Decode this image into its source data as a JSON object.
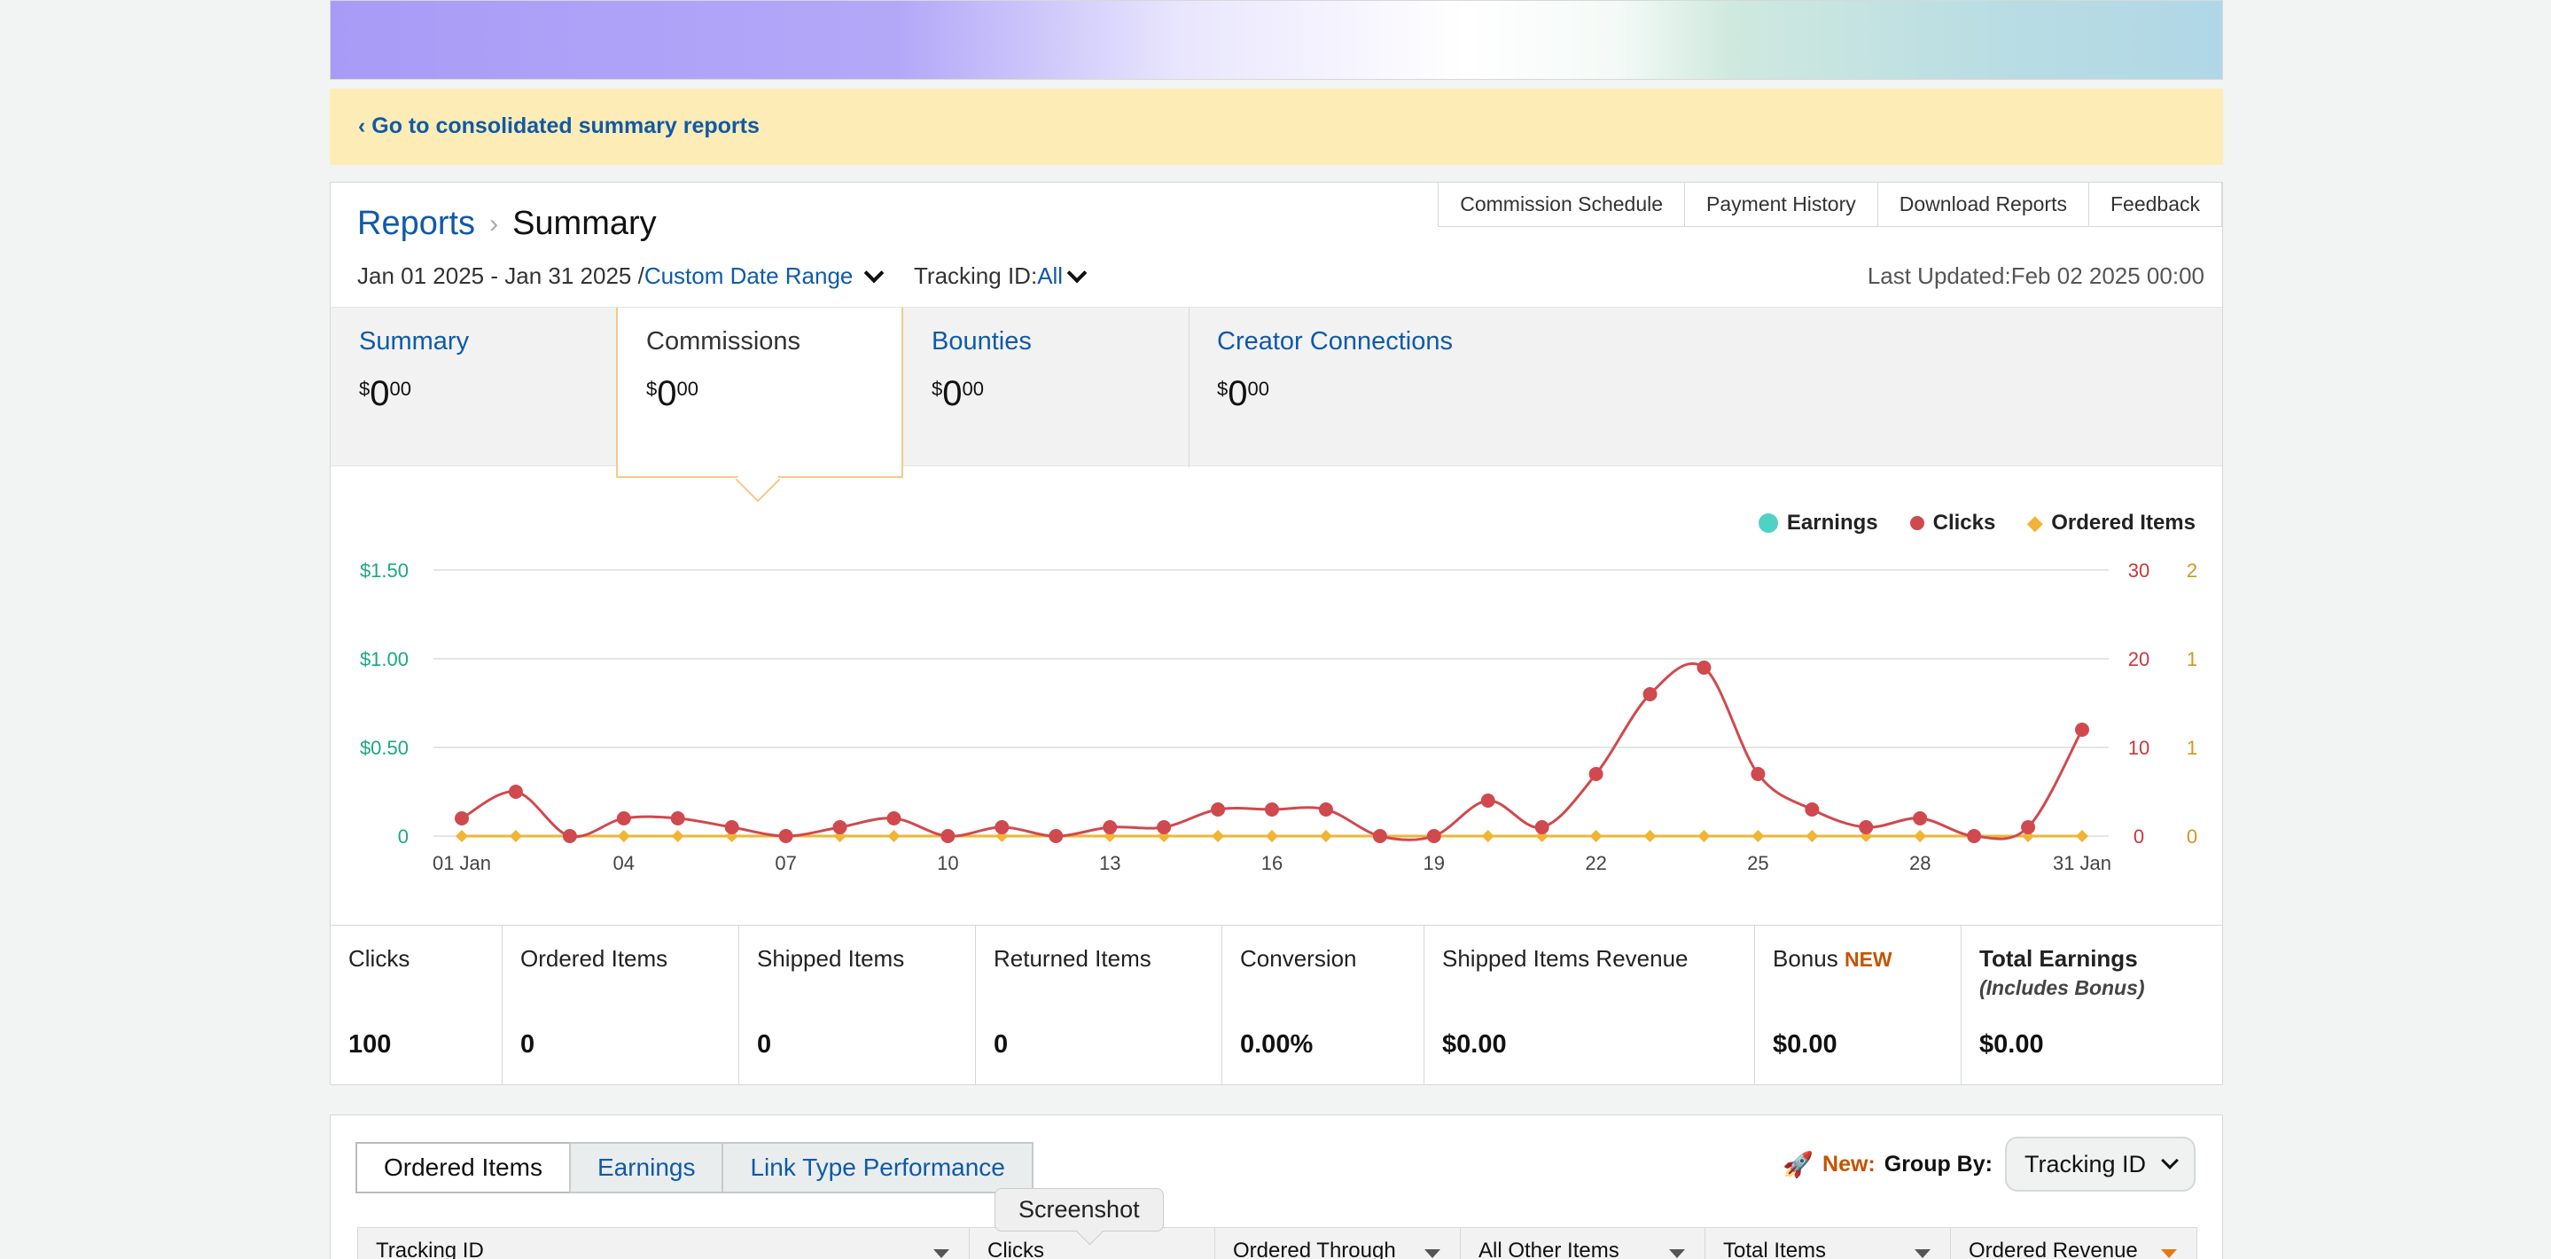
{
  "notice": {
    "link": "‹ Go to consolidated summary reports"
  },
  "topnav": [
    "Commission Schedule",
    "Payment History",
    "Download Reports",
    "Feedback"
  ],
  "breadcrumb": {
    "parent": "Reports",
    "separator": "›",
    "current": "Summary"
  },
  "date_range": {
    "dates": "Jan 01 2025 - Jan 31 2025 /",
    "selector": "Custom Date Range"
  },
  "tracking": {
    "label": "Tracking ID:",
    "value": "All"
  },
  "last_updated": "Last Updated:Feb 02 2025 00:00",
  "summary_tabs": [
    {
      "title": "Summary",
      "currency": "$",
      "whole": "0",
      "cents": "00"
    },
    {
      "title": "Commissions",
      "currency": "$",
      "whole": "0",
      "cents": "00"
    },
    {
      "title": "Bounties",
      "currency": "$",
      "whole": "0",
      "cents": "00"
    },
    {
      "title": "Creator Connections",
      "currency": "$",
      "whole": "0",
      "cents": "00"
    }
  ],
  "legend": [
    "Earnings",
    "Clicks",
    "Ordered Items"
  ],
  "colors": {
    "earnings": "#4fd1c5",
    "clicks": "#d0494e",
    "ordered": "#f0b535",
    "link": "#0f5aa8",
    "accent": "#c45500"
  },
  "chart_data": {
    "type": "line",
    "x": [
      "01 Jan",
      "02",
      "03",
      "04",
      "05",
      "06",
      "07",
      "08",
      "09",
      "10",
      "11",
      "12",
      "13",
      "14",
      "15",
      "16",
      "17",
      "18",
      "19",
      "20",
      "21",
      "22",
      "23",
      "24",
      "25",
      "26",
      "27",
      "28",
      "29",
      "30",
      "31 Jan"
    ],
    "x_tick_labels": [
      "01 Jan",
      "04",
      "07",
      "10",
      "13",
      "16",
      "19",
      "22",
      "25",
      "28",
      "31 Jan"
    ],
    "series": [
      {
        "name": "Earnings",
        "axis": "left",
        "values": [
          0,
          0,
          0,
          0,
          0,
          0,
          0,
          0,
          0,
          0,
          0,
          0,
          0,
          0,
          0,
          0,
          0,
          0,
          0,
          0,
          0,
          0,
          0,
          0,
          0,
          0,
          0,
          0,
          0,
          0,
          0
        ]
      },
      {
        "name": "Clicks",
        "axis": "right1",
        "values": [
          2,
          5,
          0,
          2,
          2,
          1,
          0,
          1,
          2,
          0,
          1,
          0,
          1,
          1,
          3,
          3,
          3,
          0,
          0,
          4,
          1,
          7,
          16,
          19,
          7,
          3,
          1,
          2,
          0,
          1,
          12
        ]
      },
      {
        "name": "Ordered Items",
        "axis": "right2",
        "values": [
          0,
          0,
          0,
          0,
          0,
          0,
          0,
          0,
          0,
          0,
          0,
          0,
          0,
          0,
          0,
          0,
          0,
          0,
          0,
          0,
          0,
          0,
          0,
          0,
          0,
          0,
          0,
          0,
          0,
          0,
          0
        ]
      }
    ],
    "y_left": {
      "ticks": [
        "0",
        "$0.50",
        "$1.00",
        "$1.50"
      ],
      "lim": [
        0,
        1.5
      ]
    },
    "y_right1": {
      "ticks": [
        "0",
        "10",
        "20",
        "30"
      ],
      "lim": [
        0,
        30
      ]
    },
    "y_right2": {
      "ticks": [
        "0",
        "1",
        "1",
        "2"
      ],
      "lim": [
        0,
        2
      ]
    },
    "grid": true,
    "legend_position": "top-right"
  },
  "stats": [
    {
      "label": "Clicks",
      "value": "100"
    },
    {
      "label": "Ordered Items",
      "value": "0"
    },
    {
      "label": "Shipped Items",
      "value": "0"
    },
    {
      "label": "Returned Items",
      "value": "0"
    },
    {
      "label": "Conversion",
      "value": "0.00%"
    },
    {
      "label": "Shipped Items Revenue",
      "value": "$0.00"
    },
    {
      "label": "Bonus",
      "tag": "NEW",
      "value": "$0.00"
    },
    {
      "label": "Total Earnings",
      "sublabel": "(Includes Bonus)",
      "value": "$0.00"
    }
  ],
  "bottom_tabs": [
    "Ordered Items",
    "Earnings",
    "Link Type Performance"
  ],
  "group_by": {
    "new_label": "New:",
    "label": "Group By:",
    "value": "Tracking ID"
  },
  "table_headers": [
    "Tracking ID",
    "Clicks",
    "Ordered Through",
    "All Other Items",
    "Total Items",
    "Ordered Revenue"
  ],
  "tooltip": "Screenshot"
}
